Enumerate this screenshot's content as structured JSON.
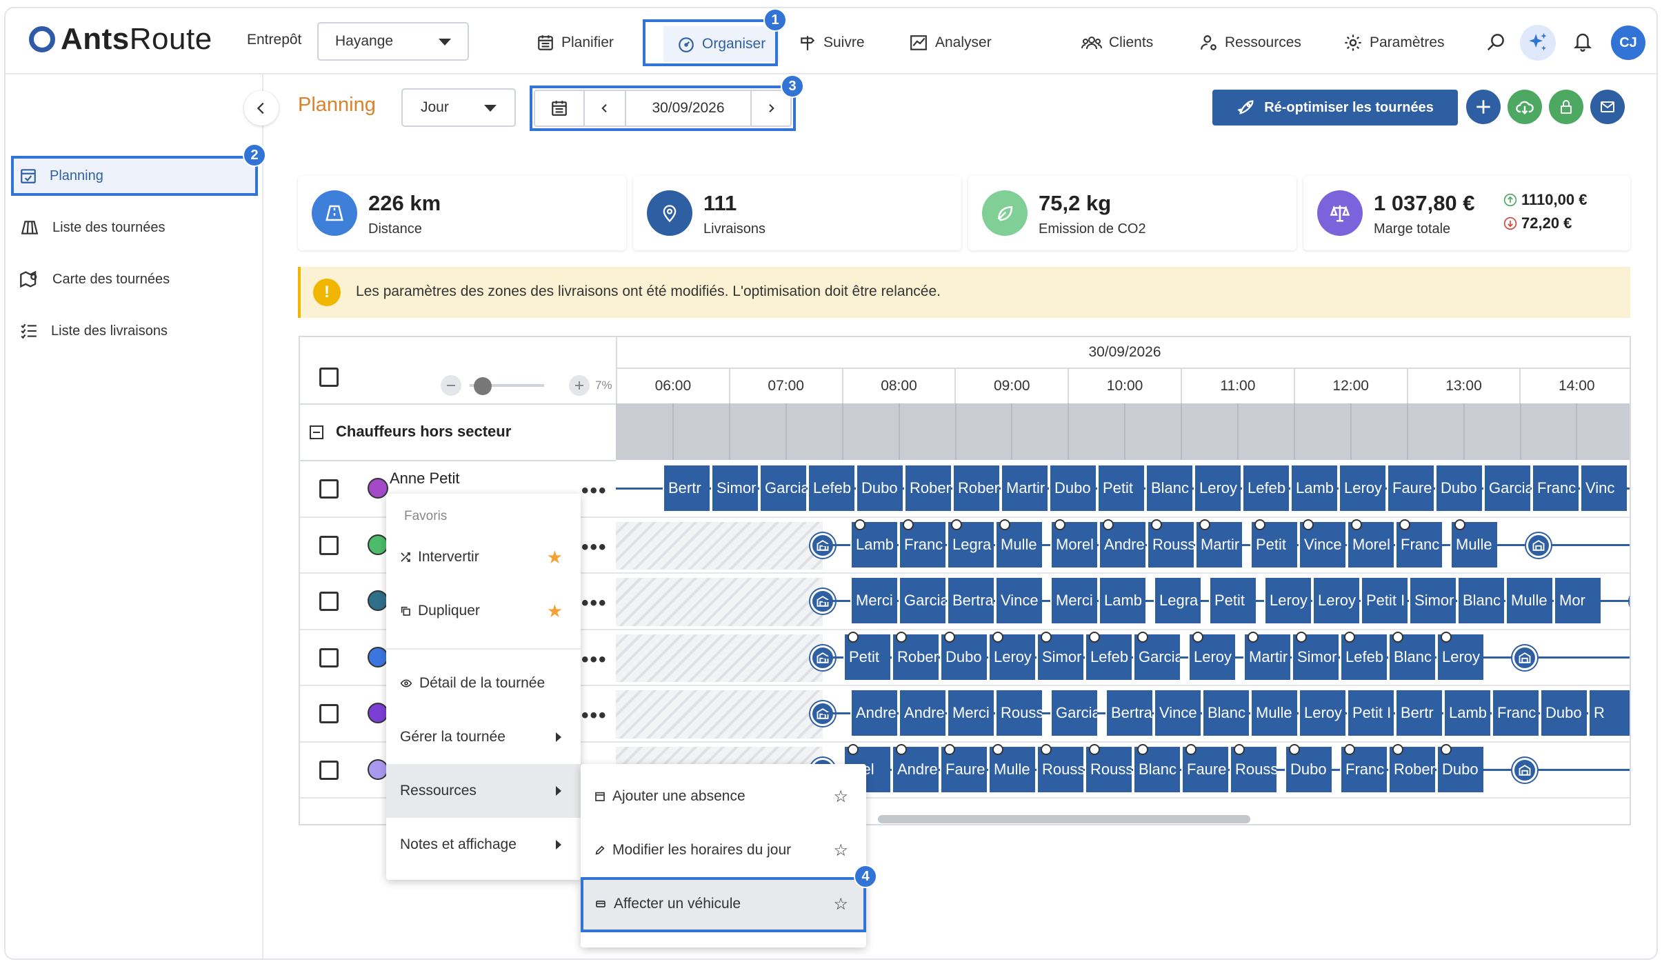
{
  "header": {
    "brand_bold": "Ants",
    "brand_light": "Route",
    "entrepot_label": "Entrepôt",
    "entrepot_value": "Hayange",
    "nav": {
      "planifier": "Planifier",
      "organiser": "Organiser",
      "suivre": "Suivre",
      "analyser": "Analyser",
      "clients": "Clients",
      "ressources": "Ressources",
      "parametres": "Paramètres"
    },
    "avatar_initials": "CJ"
  },
  "sidebar": {
    "items": [
      {
        "label": "Planning",
        "icon": "calendar-check-icon"
      },
      {
        "label": "Liste des tournées",
        "icon": "map-tour-icon"
      },
      {
        "label": "Carte des tournées",
        "icon": "map-pin-icon"
      },
      {
        "label": "Liste des livraisons",
        "icon": "list-check-icon"
      }
    ]
  },
  "toolbar": {
    "page_title": "Planning",
    "view_mode": "Jour",
    "date": "30/09/2026",
    "reoptimize_label": "Ré-optimiser les tournées"
  },
  "badges": [
    "1",
    "2",
    "3",
    "4"
  ],
  "kpis": {
    "distance": {
      "value": "226 km",
      "label": "Distance"
    },
    "deliveries": {
      "value": "111",
      "label": "Livraisons"
    },
    "co2": {
      "value": "75,2 kg",
      "label": "Emission de CO2"
    },
    "margin": {
      "value": "1 037,80 €",
      "label": "Marge totale",
      "up": "1110,00 €",
      "down": "72,20 €"
    }
  },
  "warning": {
    "icon": "!",
    "text": "Les paramètres des zones des livraisons ont été modifiés. L'optimisation doit être relancée."
  },
  "gantt": {
    "date": "30/09/2026",
    "zoom": "7%",
    "hours": [
      "06:00",
      "07:00",
      "08:00",
      "09:00",
      "10:00",
      "11:00",
      "12:00",
      "13:00",
      "14:00"
    ],
    "group_label": "Chauffeurs hors secteur",
    "first_driver": "Anne Petit",
    "row_colors": [
      "#a349c7",
      "#4cbc6a",
      "#2f6f8a",
      "#3b76e0",
      "#7b3fd6",
      "#a99af0"
    ],
    "rows": [
      [
        "Bertr",
        "Simor",
        "Garcia",
        "Lefeb",
        "Dubo",
        "Rober",
        "Rober",
        "Martir",
        "Dubo",
        "Petit",
        "Blanc",
        "Leroy",
        "Lefeb",
        "Lamb",
        "Leroy",
        "Faure",
        "Dubo",
        "Garcia",
        "Franc",
        "Vinc"
      ],
      [
        "Lamb",
        "Franc",
        "Legra",
        "Mulle",
        "Morel",
        "Andre",
        "Rouss",
        "Martir",
        "Petit",
        "Vince",
        "Morel",
        "Franc",
        "Mulle"
      ],
      [
        "Merci",
        "Garcia",
        "Bertra",
        "Vince",
        "Merci",
        "Lamb",
        "Legra",
        "Petit",
        "Leroy",
        "Leroy",
        "Petit I",
        "Simor",
        "Blanc",
        "Mulle",
        "Mor"
      ],
      [
        "Petit",
        "Rober",
        "Dubo",
        "Leroy",
        "Simor",
        "Lefeb",
        "Garcia",
        "Leroy",
        "Martir",
        "Simor",
        "Lefeb",
        "Blanc",
        "Leroy"
      ],
      [
        "Andre",
        "Andre",
        "Merci",
        "Rouss",
        "Garcia",
        "Bertra",
        "Vince",
        "Blanc",
        "Mulle",
        "Leroy",
        "Petit I",
        "Bertr",
        "Lamb",
        "Franc",
        "Dubo",
        "R"
      ],
      [
        "orel",
        "Andre",
        "Faure",
        "Mulle",
        "Rouss",
        "Rouss",
        "Blanc",
        "Faure",
        "Rouss",
        "Dubo",
        "Franc",
        "Rober",
        "Dubo"
      ]
    ]
  },
  "context_menu": {
    "favorites_header": "Favoris",
    "intervertir": "Intervertir",
    "dupliquer": "Dupliquer",
    "detail": "Détail de la tournée",
    "gerer": "Gérer la tournée",
    "ressources": "Ressources",
    "notes": "Notes et affichage"
  },
  "submenu": {
    "absence": "Ajouter une absence",
    "horaires": "Modifier les horaires du jour",
    "vehicule": "Affecter un véhicule"
  },
  "colors": {
    "accent": "#3273d6",
    "slot": "#2f5fa3",
    "title_orange": "#d9822b",
    "warning_bg": "#fbf1d3",
    "warning_icon": "#f1b600"
  }
}
